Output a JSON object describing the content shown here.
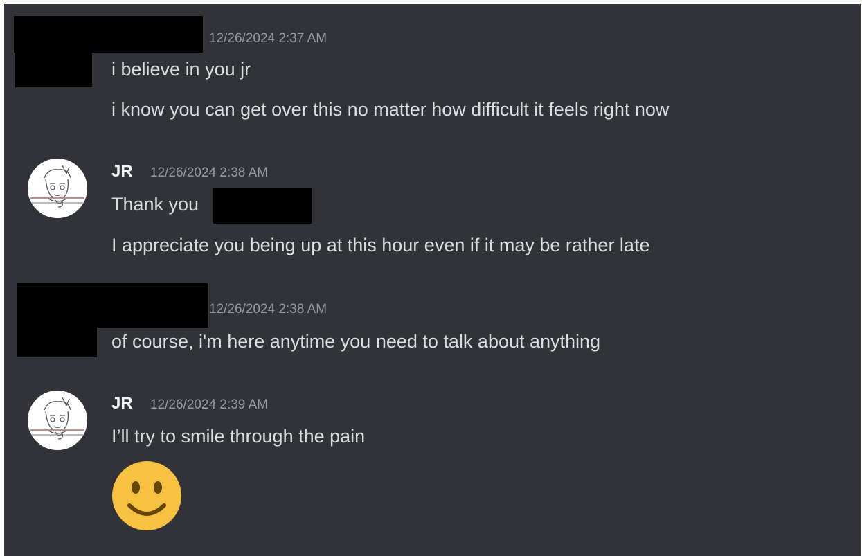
{
  "messages": [
    {
      "author": "[redacted]",
      "timestamp": "12/26/2024 2:37 AM",
      "lines": [
        "i believe in you jr",
        "i know you can get over this no matter how difficult it feels right now"
      ]
    },
    {
      "author": "JR",
      "avatar_icon": "sketch-avatar-icon",
      "timestamp": "12/26/2024 2:38 AM",
      "lines": [
        "Thank you",
        "I appreciate you being up at this hour even if it may be rather late"
      ]
    },
    {
      "author": "[redacted]",
      "timestamp": "12/26/2024 2:38 AM",
      "lines": [
        "of course, i'm here anytime you need to talk about anything"
      ]
    },
    {
      "author": "JR",
      "avatar_icon": "sketch-avatar-icon",
      "timestamp": "12/26/2024 2:39 AM",
      "lines": [
        "I’ll try to smile through the pain"
      ],
      "emoji": "slightly-smiling-face-icon"
    }
  ],
  "colors": {
    "background": "#313338",
    "message_text": "#dbdee1",
    "username": "#f2f3f5",
    "timestamp": "#949ba4",
    "redaction": "#000000",
    "emoji_face": "#f7c242"
  }
}
